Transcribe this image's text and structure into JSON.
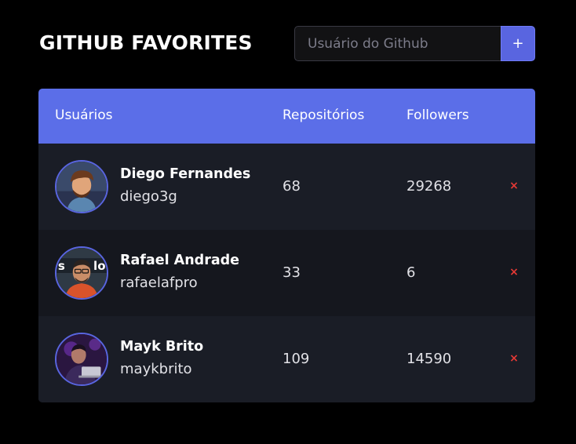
{
  "header": {
    "title": "GITHUB FAVORITES"
  },
  "search": {
    "placeholder": "Usuário do Github",
    "value": "",
    "add_label": "+"
  },
  "table": {
    "columns": [
      "Usuários",
      "Repositórios",
      "Followers"
    ],
    "rows": [
      {
        "name": "Diego Fernandes",
        "login": "diego3g",
        "repositories": "68",
        "followers": "29268",
        "remove_label": "×"
      },
      {
        "name": "Rafael Andrade",
        "login": "rafaelafpro",
        "repositories": "33",
        "followers": "6",
        "remove_label": "×"
      },
      {
        "name": "Mayk Brito",
        "login": "maykbrito",
        "repositories": "109",
        "followers": "14590",
        "remove_label": "×"
      }
    ]
  },
  "colors": {
    "background": "#000000",
    "accent": "#5965e0",
    "table_header": "#5b6ee8",
    "row_odd": "#1a1d26",
    "row_even": "#15171e",
    "remove": "#e53935"
  },
  "icons": {
    "add": "plus-icon",
    "remove": "close-icon",
    "avatar": "avatar-image"
  }
}
